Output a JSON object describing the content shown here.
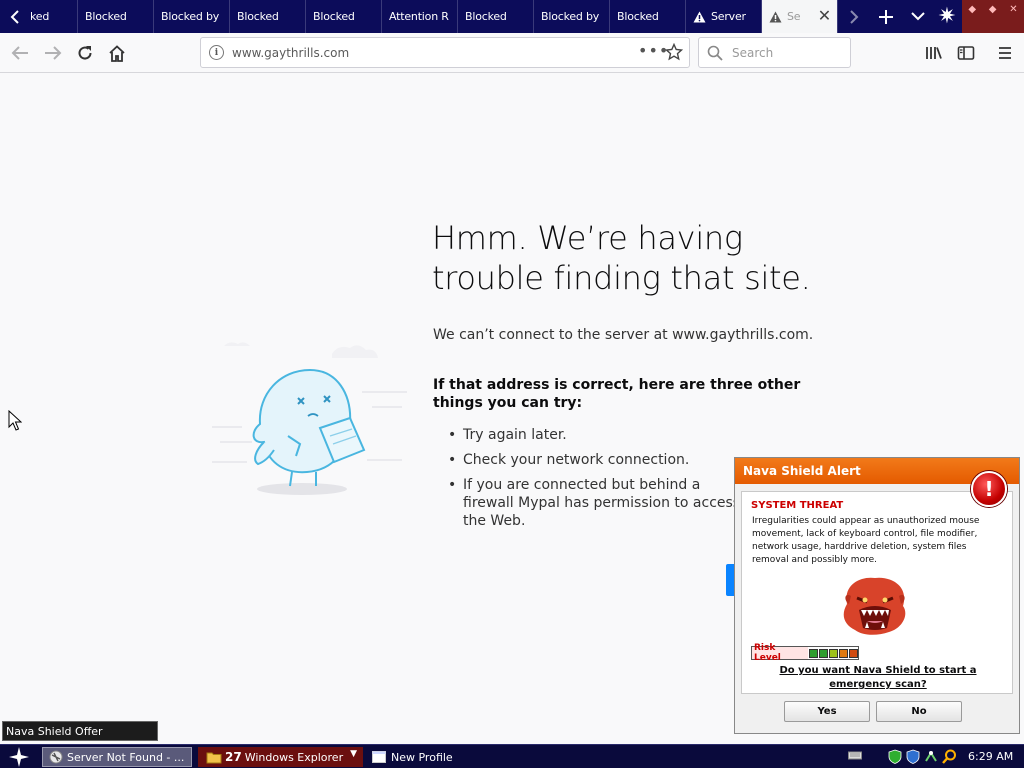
{
  "browser": {
    "tabs": [
      {
        "label": "ked",
        "icon": "none",
        "state": "normal"
      },
      {
        "label": "Blocked",
        "icon": "none",
        "state": "normal"
      },
      {
        "label": "Blocked by",
        "icon": "none",
        "state": "normal"
      },
      {
        "label": "Blocked",
        "icon": "none",
        "state": "normal"
      },
      {
        "label": "Blocked",
        "icon": "none",
        "state": "normal"
      },
      {
        "label": "Attention R",
        "icon": "none",
        "state": "normal"
      },
      {
        "label": "Blocked",
        "icon": "none",
        "state": "normal"
      },
      {
        "label": "Blocked by",
        "icon": "none",
        "state": "normal"
      },
      {
        "label": "Blocked",
        "icon": "none",
        "state": "normal"
      },
      {
        "label": "Server",
        "icon": "warning-icon",
        "state": "normal"
      },
      {
        "label": "Se",
        "icon": "warning-icon",
        "state": "active"
      }
    ],
    "url": "www.gaythrills.com",
    "page_actions": "•••",
    "search_placeholder": "Search"
  },
  "error_page": {
    "title": "Hmm. We’re having trouble finding that site.",
    "description": "We can’t connect to the server at www.gaythrills.com.",
    "advice_heading": "If that address is correct, here are three other things you can try:",
    "suggestions": [
      "Try again later.",
      "Check your network connection.",
      "If you are connected but behind a firewall Mypal has permission to access the Web."
    ]
  },
  "alert": {
    "header": "Nava Shield Alert",
    "threat_label": "SYSTEM THREAT",
    "message": "Irregularities could appear as unauthorized mouse movement, lack of keyboard control, file modifier, network usage, harddrive deletion, system files removal and possibly more.",
    "risk_label": "Risk Level",
    "risk_colors": [
      "#2e9e2e",
      "#2e9e2e",
      "#9ec21a",
      "#e07a10",
      "#d04a10"
    ],
    "question": "Do you want Nava Shield to start a emergency scan?",
    "yes_label": "Yes",
    "no_label": "No"
  },
  "tooltip": "Nava Shield Offer",
  "taskbar": {
    "firefox_task": "Server Not Found - ...",
    "explorer_count": "27",
    "explorer_task": "Windows Explorer",
    "profile_task": "New Profile",
    "clock": "6:29 AM"
  },
  "colors": {
    "tabstrip": "#0c0c5a",
    "accent_blue": "#0a84ff",
    "alert_orange": "#e45a00"
  }
}
